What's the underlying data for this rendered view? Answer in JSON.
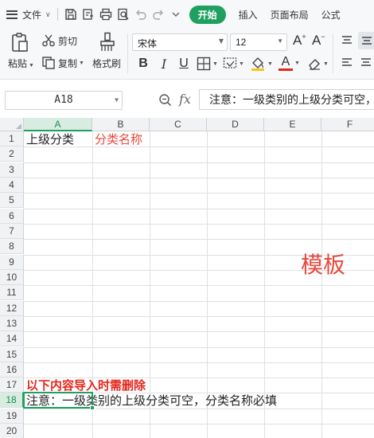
{
  "menu": {
    "file_label": "文件",
    "tabs": [
      "开始",
      "插入",
      "页面布局",
      "公式"
    ]
  },
  "ribbon": {
    "paste_label": "粘贴",
    "cut_label": "剪切",
    "copy_label": "复制",
    "format_painter_label": "格式刷",
    "font_name": "宋体",
    "font_size": "12",
    "bold_label": "B",
    "italic_label": "I",
    "underline_label": "U",
    "font_color_label": "A",
    "grow_font_label": "A",
    "shrink_font_label": "A"
  },
  "formula_bar": {
    "name_box": "A18",
    "fx_label": "fx",
    "content": "注意：一级类别的上级分类可空，分类名称必填"
  },
  "sheet": {
    "columns": [
      "A",
      "B",
      "C",
      "D",
      "E",
      "F"
    ],
    "rows": [
      "1",
      "2",
      "3",
      "4",
      "5",
      "6",
      "7",
      "8",
      "9",
      "10",
      "11",
      "12",
      "13",
      "14",
      "15",
      "16",
      "17",
      "18",
      "19",
      "20"
    ],
    "active_column": "A",
    "active_row": "18",
    "cells": {
      "a1": "上级分类",
      "b1": "分类名称",
      "a17": "以下内容导入时需删除",
      "a18": "注意：一级类别的上级分类可空，分类名称必填"
    },
    "watermark": "模板"
  },
  "colors": {
    "accent": "#1fa060",
    "red_text": "#e8483c",
    "bold_red": "#e5261a"
  }
}
